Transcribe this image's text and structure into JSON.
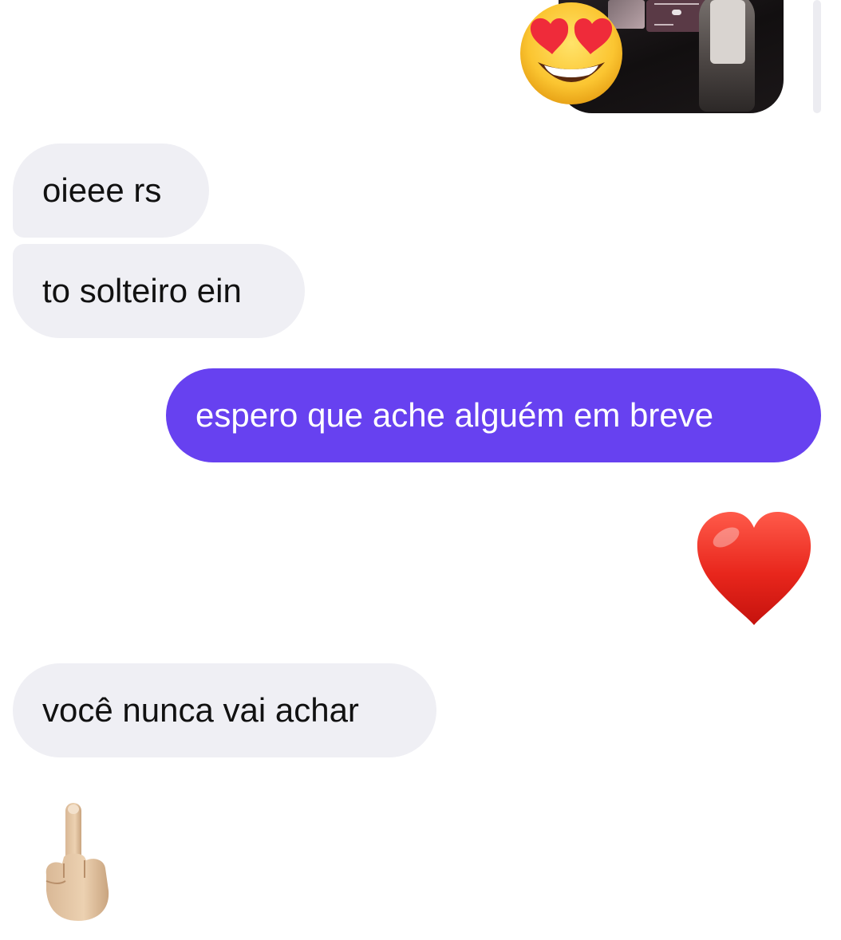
{
  "conversation": {
    "messages": [
      {
        "direction": "incoming",
        "text": "oieee rs"
      },
      {
        "direction": "incoming",
        "text": "to solteiro ein"
      },
      {
        "direction": "outgoing",
        "text": "espero que ache alguém em breve"
      },
      {
        "direction": "outgoing",
        "emoji": "red-heart-icon"
      },
      {
        "direction": "incoming",
        "text": "você nunca vai achar"
      },
      {
        "direction": "incoming",
        "emoji": "middle-finger-icon"
      }
    ]
  },
  "shared_photo": {
    "reaction": "heart-eyes-emoji-icon"
  },
  "colors": {
    "outgoing_bubble": "#6741f0",
    "incoming_bubble": "#efeff4",
    "incoming_text": "#111111",
    "outgoing_text": "#ffffff"
  }
}
